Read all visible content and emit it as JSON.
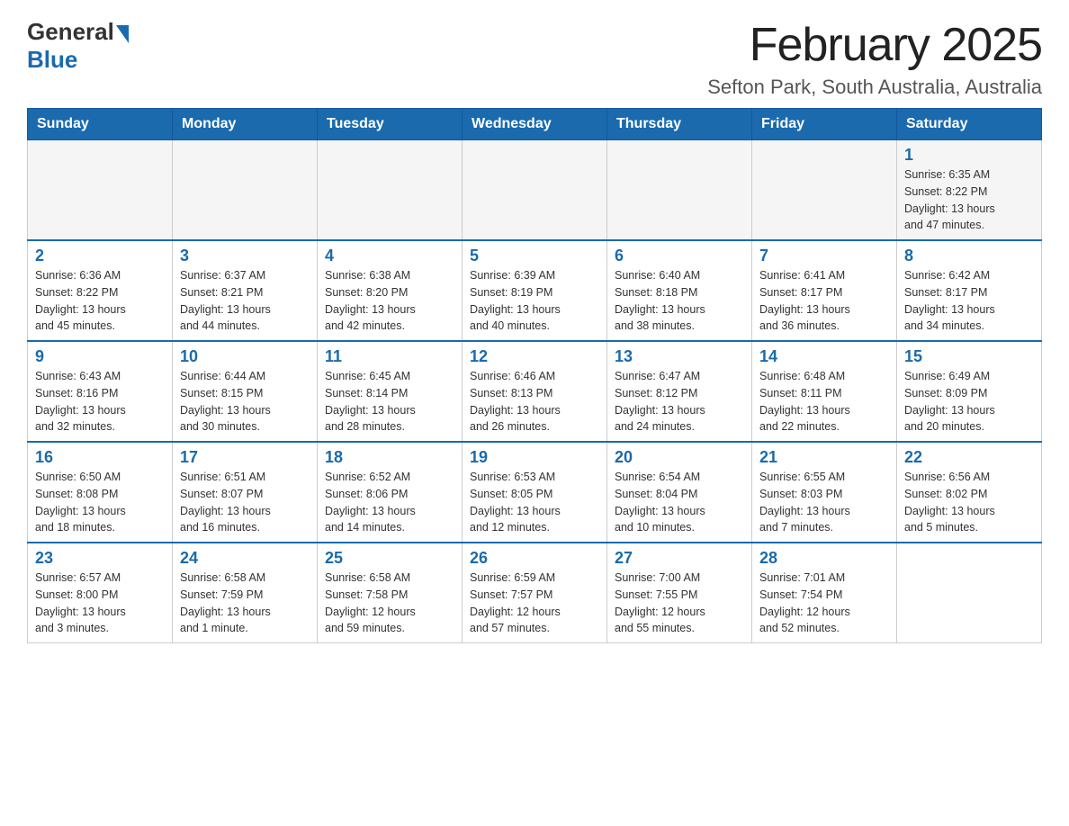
{
  "header": {
    "logo_general": "General",
    "logo_blue": "Blue",
    "title": "February 2025",
    "subtitle": "Sefton Park, South Australia, Australia"
  },
  "days_of_week": [
    "Sunday",
    "Monday",
    "Tuesday",
    "Wednesday",
    "Thursday",
    "Friday",
    "Saturday"
  ],
  "weeks": [
    [
      {
        "day": null,
        "info": null
      },
      {
        "day": null,
        "info": null
      },
      {
        "day": null,
        "info": null
      },
      {
        "day": null,
        "info": null
      },
      {
        "day": null,
        "info": null
      },
      {
        "day": null,
        "info": null
      },
      {
        "day": "1",
        "info": "Sunrise: 6:35 AM\nSunset: 8:22 PM\nDaylight: 13 hours\nand 47 minutes."
      }
    ],
    [
      {
        "day": "2",
        "info": "Sunrise: 6:36 AM\nSunset: 8:22 PM\nDaylight: 13 hours\nand 45 minutes."
      },
      {
        "day": "3",
        "info": "Sunrise: 6:37 AM\nSunset: 8:21 PM\nDaylight: 13 hours\nand 44 minutes."
      },
      {
        "day": "4",
        "info": "Sunrise: 6:38 AM\nSunset: 8:20 PM\nDaylight: 13 hours\nand 42 minutes."
      },
      {
        "day": "5",
        "info": "Sunrise: 6:39 AM\nSunset: 8:19 PM\nDaylight: 13 hours\nand 40 minutes."
      },
      {
        "day": "6",
        "info": "Sunrise: 6:40 AM\nSunset: 8:18 PM\nDaylight: 13 hours\nand 38 minutes."
      },
      {
        "day": "7",
        "info": "Sunrise: 6:41 AM\nSunset: 8:17 PM\nDaylight: 13 hours\nand 36 minutes."
      },
      {
        "day": "8",
        "info": "Sunrise: 6:42 AM\nSunset: 8:17 PM\nDaylight: 13 hours\nand 34 minutes."
      }
    ],
    [
      {
        "day": "9",
        "info": "Sunrise: 6:43 AM\nSunset: 8:16 PM\nDaylight: 13 hours\nand 32 minutes."
      },
      {
        "day": "10",
        "info": "Sunrise: 6:44 AM\nSunset: 8:15 PM\nDaylight: 13 hours\nand 30 minutes."
      },
      {
        "day": "11",
        "info": "Sunrise: 6:45 AM\nSunset: 8:14 PM\nDaylight: 13 hours\nand 28 minutes."
      },
      {
        "day": "12",
        "info": "Sunrise: 6:46 AM\nSunset: 8:13 PM\nDaylight: 13 hours\nand 26 minutes."
      },
      {
        "day": "13",
        "info": "Sunrise: 6:47 AM\nSunset: 8:12 PM\nDaylight: 13 hours\nand 24 minutes."
      },
      {
        "day": "14",
        "info": "Sunrise: 6:48 AM\nSunset: 8:11 PM\nDaylight: 13 hours\nand 22 minutes."
      },
      {
        "day": "15",
        "info": "Sunrise: 6:49 AM\nSunset: 8:09 PM\nDaylight: 13 hours\nand 20 minutes."
      }
    ],
    [
      {
        "day": "16",
        "info": "Sunrise: 6:50 AM\nSunset: 8:08 PM\nDaylight: 13 hours\nand 18 minutes."
      },
      {
        "day": "17",
        "info": "Sunrise: 6:51 AM\nSunset: 8:07 PM\nDaylight: 13 hours\nand 16 minutes."
      },
      {
        "day": "18",
        "info": "Sunrise: 6:52 AM\nSunset: 8:06 PM\nDaylight: 13 hours\nand 14 minutes."
      },
      {
        "day": "19",
        "info": "Sunrise: 6:53 AM\nSunset: 8:05 PM\nDaylight: 13 hours\nand 12 minutes."
      },
      {
        "day": "20",
        "info": "Sunrise: 6:54 AM\nSunset: 8:04 PM\nDaylight: 13 hours\nand 10 minutes."
      },
      {
        "day": "21",
        "info": "Sunrise: 6:55 AM\nSunset: 8:03 PM\nDaylight: 13 hours\nand 7 minutes."
      },
      {
        "day": "22",
        "info": "Sunrise: 6:56 AM\nSunset: 8:02 PM\nDaylight: 13 hours\nand 5 minutes."
      }
    ],
    [
      {
        "day": "23",
        "info": "Sunrise: 6:57 AM\nSunset: 8:00 PM\nDaylight: 13 hours\nand 3 minutes."
      },
      {
        "day": "24",
        "info": "Sunrise: 6:58 AM\nSunset: 7:59 PM\nDaylight: 13 hours\nand 1 minute."
      },
      {
        "day": "25",
        "info": "Sunrise: 6:58 AM\nSunset: 7:58 PM\nDaylight: 12 hours\nand 59 minutes."
      },
      {
        "day": "26",
        "info": "Sunrise: 6:59 AM\nSunset: 7:57 PM\nDaylight: 12 hours\nand 57 minutes."
      },
      {
        "day": "27",
        "info": "Sunrise: 7:00 AM\nSunset: 7:55 PM\nDaylight: 12 hours\nand 55 minutes."
      },
      {
        "day": "28",
        "info": "Sunrise: 7:01 AM\nSunset: 7:54 PM\nDaylight: 12 hours\nand 52 minutes."
      },
      {
        "day": null,
        "info": null
      }
    ]
  ]
}
